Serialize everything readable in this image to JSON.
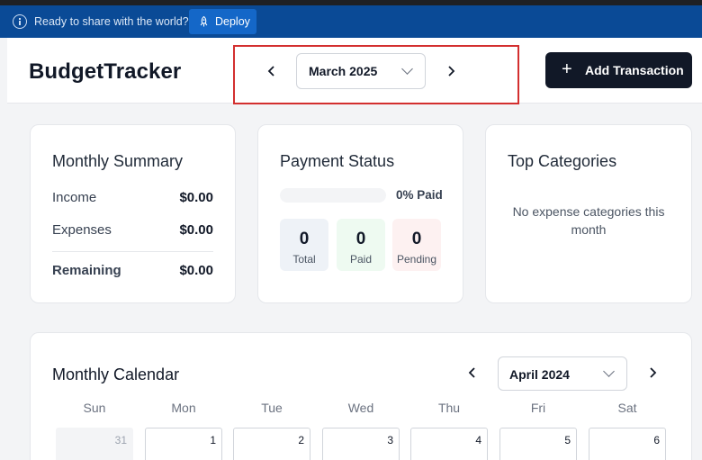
{
  "banner": {
    "message": "Ready to share with the world?",
    "deploy_label": "Deploy"
  },
  "header": {
    "brand": "BudgetTracker",
    "selected_month": "March 2025",
    "add_label": "Add Transaction"
  },
  "summary": {
    "title": "Monthly Summary",
    "rows": [
      {
        "label": "Income",
        "value": "$0.00"
      },
      {
        "label": "Expenses",
        "value": "$0.00"
      },
      {
        "label": "Remaining",
        "value": "$0.00"
      }
    ]
  },
  "payment": {
    "title": "Payment Status",
    "progress_fraction": 0,
    "paid_text": "0% Paid",
    "stats": [
      {
        "value": "0",
        "label": "Total",
        "color": "#eef2f7"
      },
      {
        "value": "0",
        "label": "Paid",
        "color": "#eefaf1"
      },
      {
        "value": "0",
        "label": "Pending",
        "color": "#fdf1f1"
      }
    ]
  },
  "categories": {
    "title": "Top Categories",
    "empty_message": "No expense categories this month"
  },
  "calendar": {
    "title": "Monthly Calendar",
    "selected_month": "April 2024",
    "weekdays": [
      "Sun",
      "Mon",
      "Tue",
      "Wed",
      "Thu",
      "Fri",
      "Sat"
    ],
    "first_row": [
      "31",
      "1",
      "2",
      "3",
      "4",
      "5",
      "6"
    ]
  }
}
